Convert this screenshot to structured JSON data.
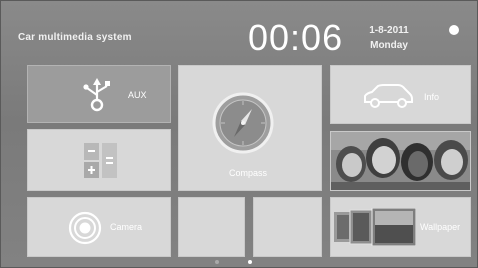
{
  "header": {
    "title": "Car multimedia system",
    "time": "00:06",
    "date": "1-8-2011",
    "weekday": "Monday"
  },
  "tiles": {
    "aux": {
      "label": "AUX",
      "icon": "usb-icon"
    },
    "calculator": {
      "icon": "calculator-icon"
    },
    "camera": {
      "label": "Camera",
      "icon": "camera-icon"
    },
    "compass": {
      "label": "Compass",
      "icon": "compass-icon"
    },
    "info": {
      "label": "Info",
      "icon": "car-icon"
    },
    "photos": {
      "icon": "photo-thumbnail"
    },
    "wallpaper": {
      "label": "Wallpaper",
      "icon": "wallpaper-thumbnail"
    }
  },
  "pager": {
    "pages": 2,
    "active": 2
  },
  "colors": {
    "tile": "#d8d8d8",
    "aux_tile": "#9c9c9c",
    "background": "#7a7a7a",
    "text": "#ffffff"
  }
}
